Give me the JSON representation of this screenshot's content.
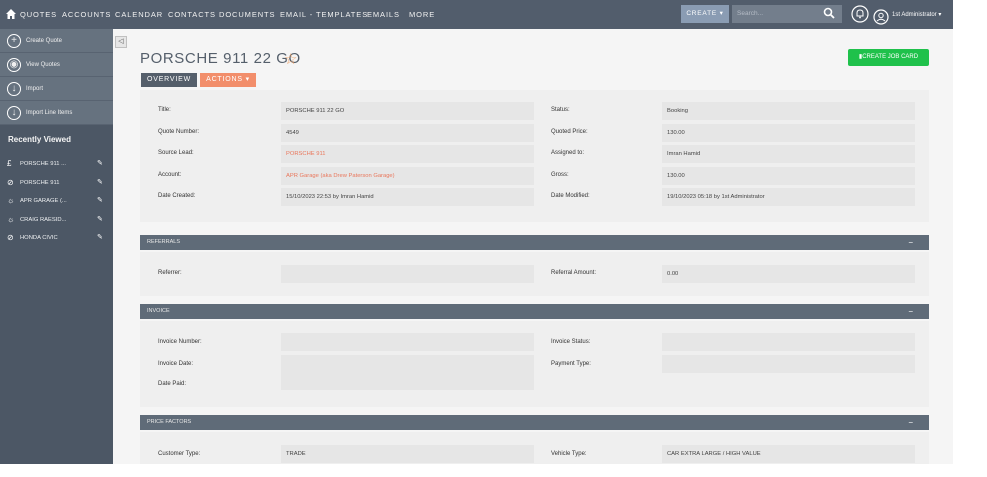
{
  "nav": {
    "items": [
      "QUOTES",
      "ACCOUNTS",
      "CALENDAR",
      "CONTACTS",
      "DOCUMENTS",
      "EMAIL - TEMPLATES",
      "EMAILS",
      "MORE"
    ],
    "create_label": "CREATE ▾",
    "search_placeholder": "Search...",
    "user_name": "1st Administrator ▾"
  },
  "sidebar": {
    "actions": [
      {
        "label": "Create Quote",
        "icon": "+"
      },
      {
        "label": "View Quotes",
        "icon": "◉"
      },
      {
        "label": "Import",
        "icon": "↓"
      },
      {
        "label": "Import Line Items",
        "icon": "↓"
      }
    ],
    "recent_title": "Recently Viewed",
    "recent": [
      {
        "label": "PORSCHE 911 ...",
        "icon": "£"
      },
      {
        "label": "PORSCHE 911",
        "icon": "⊘"
      },
      {
        "label": "APR GARAGE (...",
        "icon": "☼"
      },
      {
        "label": "CRAIG RAESID...",
        "icon": "☼"
      },
      {
        "label": "HONDA CIVIC",
        "icon": "⊘"
      }
    ],
    "edit_glyph": "✎"
  },
  "record": {
    "title": "PORSCHE 911 22 GO",
    "create_job_card": "CREATE JOB CARD",
    "tab_overview": "OVERVIEW",
    "tab_actions": "ACTIONS ▾"
  },
  "overview": {
    "left": [
      {
        "label": "Title:",
        "value": "PORSCHE 911 22 GO"
      },
      {
        "label": "Quote Number:",
        "value": "4549"
      },
      {
        "label": "Source Lead:",
        "value": "PORSCHE 911"
      },
      {
        "label": "Account:",
        "value": "APR Garage (aka Drew Paterson Garage)"
      },
      {
        "label": "Date Created:",
        "value": "15/10/2023 22:53 by Imran Hamid"
      }
    ],
    "right": [
      {
        "label": "Status:",
        "value": "Booking"
      },
      {
        "label": "Quoted Price:",
        "value": "130.00"
      },
      {
        "label": "Assigned to:",
        "value": "Imran Hamid"
      },
      {
        "label": "Gross:",
        "value": "130.00"
      },
      {
        "label": "Date Modified:",
        "value": "19/10/2023 05:18 by 1st Administrator"
      }
    ]
  },
  "referrals": {
    "header": "REFERRALS",
    "referrer_label": "Referrer:",
    "referrer_value": "",
    "amount_label": "Referral Amount:",
    "amount_value": "0.00"
  },
  "invoice": {
    "header": "INVOICE",
    "number_label": "Invoice Number:",
    "date_label": "Invoice Date:",
    "paid_label": "Date Paid:",
    "status_label": "Invoice Status:",
    "payment_label": "Payment Type:"
  },
  "price_factors": {
    "header": "PRICE FACTORS",
    "customer_label": "Customer Type:",
    "customer_value": "TRADE",
    "vehicle_label": "Vehicle Type:",
    "vehicle_value": "CAR EXTRA LARGE / HIGH VALUE"
  },
  "panel_toggle": "−",
  "colors": {
    "nav": "#525d6c",
    "sidebar": "#4c5765",
    "accent": "#f28e6b",
    "green": "#1fc14b"
  }
}
